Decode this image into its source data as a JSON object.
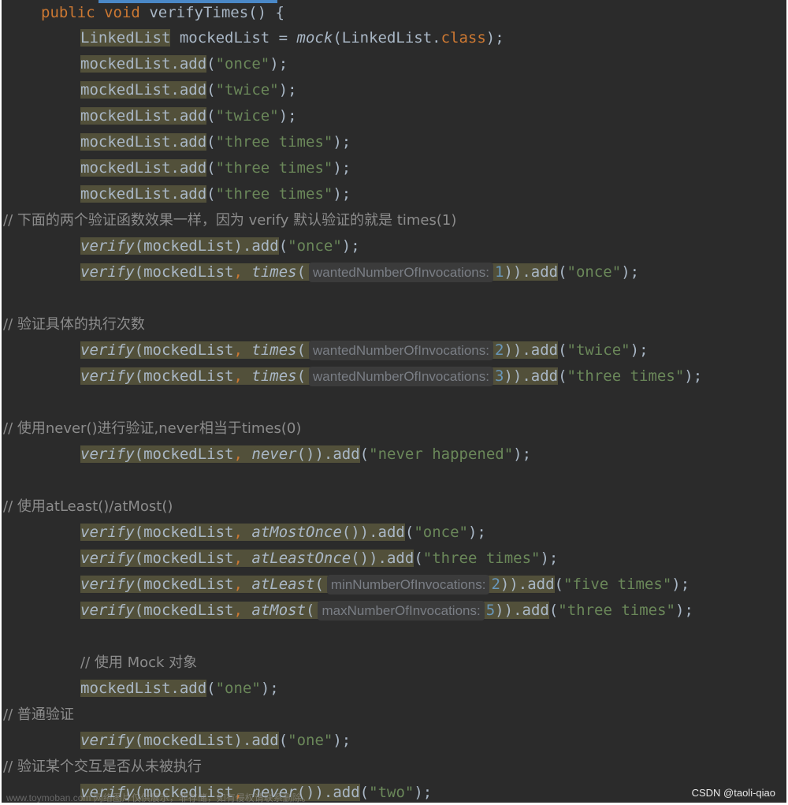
{
  "code": {
    "l0": {
      "kw1": "public",
      "kw2": "void",
      "name": "verifyTimes",
      "rest": "() {"
    },
    "l1": {
      "type": "LinkedList",
      "var": " mockedList = ",
      "fn": "mock",
      "open": "(LinkedList.",
      "cls": "class",
      "close": ");"
    },
    "l2": {
      "call": "mockedList.add",
      "open": "(",
      "str": "\"once\"",
      "close": ");"
    },
    "l3": {
      "call": "mockedList.add",
      "open": "(",
      "str": "\"twice\"",
      "close": ");"
    },
    "l4": {
      "call": "mockedList.add",
      "open": "(",
      "str": "\"twice\"",
      "close": ");"
    },
    "l5": {
      "call": "mockedList.add",
      "open": "(",
      "str": "\"three times\"",
      "close": ");"
    },
    "l6": {
      "call": "mockedList.add",
      "open": "(",
      "str": "\"three times\"",
      "close": ");"
    },
    "l7": {
      "call": "mockedList.add",
      "open": "(",
      "str": "\"three times\"",
      "close": ");"
    },
    "c1": "// 下面的两个验证函数效果一样，因为 verify 默认验证的就是 times(1)",
    "l8": {
      "fn": "verify",
      "args": "(mockedList)",
      "add": ".add",
      "open": "(",
      "str": "\"once\"",
      "close": ");"
    },
    "l9": {
      "fn": "verify",
      "args": "(mockedList",
      "comma": ", ",
      "fn2": "times",
      "open2": "(",
      "hint": "wantedNumberOfInvocations:",
      "num": "1",
      "close2": "))",
      "add": ".add",
      "open": "(",
      "str": "\"once\"",
      "close": ");"
    },
    "c2": "// 验证具体的执行次数",
    "l10": {
      "fn": "verify",
      "args": "(mockedList",
      "comma": ", ",
      "fn2": "times",
      "open2": "(",
      "hint": "wantedNumberOfInvocations:",
      "num": "2",
      "close2": "))",
      "add": ".add",
      "open": "(",
      "str": "\"twice\"",
      "close": ");"
    },
    "l11": {
      "fn": "verify",
      "args": "(mockedList",
      "comma": ", ",
      "fn2": "times",
      "open2": "(",
      "hint": "wantedNumberOfInvocations:",
      "num": "3",
      "close2": "))",
      "add": ".add",
      "open": "(",
      "str": "\"three times\"",
      "close": ");"
    },
    "c3": "// 使用never()进行验证,never相当于times(0)",
    "l12": {
      "fn": "verify",
      "args": "(mockedList",
      "comma": ", ",
      "fn2": "never",
      "inner": "())",
      "add": ".add",
      "open": "(",
      "str": "\"never happened\"",
      "close": ");"
    },
    "c4": "// 使用atLeast()/atMost()",
    "l13": {
      "fn": "verify",
      "args": "(mockedList",
      "comma": ", ",
      "fn2": "atMostOnce",
      "inner": "())",
      "add": ".add",
      "open": "(",
      "str": "\"once\"",
      "close": ");"
    },
    "l14": {
      "fn": "verify",
      "args": "(mockedList",
      "comma": ", ",
      "fn2": "atLeastOnce",
      "inner": "())",
      "add": ".add",
      "open": "(",
      "str": "\"three times\"",
      "close": ");"
    },
    "l15": {
      "fn": "verify",
      "args": "(mockedList",
      "comma": ", ",
      "fn2": "atLeast",
      "open2": "(",
      "hint": "minNumberOfInvocations:",
      "num": "2",
      "close2": "))",
      "add": ".add",
      "open": "(",
      "str": "\"five times\"",
      "close": ");"
    },
    "l16": {
      "fn": "verify",
      "args": "(mockedList",
      "comma": ", ",
      "fn2": "atMost",
      "open2": "(",
      "hint": "maxNumberOfInvocations:",
      "num": "5",
      "close2": "))",
      "add": ".add",
      "open": "(",
      "str": "\"three times\"",
      "close": ");"
    },
    "c5": "// 使用 Mock 对象",
    "l17": {
      "call": "mockedList.add",
      "open": "(",
      "str": "\"one\"",
      "close": ");"
    },
    "c6": "// 普通验证",
    "l18": {
      "fn": "verify",
      "args": "(mockedList)",
      "add": ".add",
      "open": "(",
      "str": "\"one\"",
      "close": ");"
    },
    "c7": "// 验证某个交互是否从未被执行",
    "l19": {
      "fn": "verify",
      "args": "(mockedList",
      "comma": ", ",
      "fn2": "never",
      "inner": "())",
      "add": ".add",
      "open": "(",
      "str": "\"two\"",
      "close": ");"
    }
  },
  "watermark": {
    "left": "www.toymoban.com 网络图片仅供展示，非存储，如有侵权请联系删除。",
    "right": "CSDN @taoli-qiao"
  },
  "colors": {
    "background": "#2b2b2b",
    "keyword": "#cc7832",
    "string": "#6a8759",
    "number": "#6897bb",
    "comment": "#808080",
    "usage_highlight": "#52503a"
  }
}
